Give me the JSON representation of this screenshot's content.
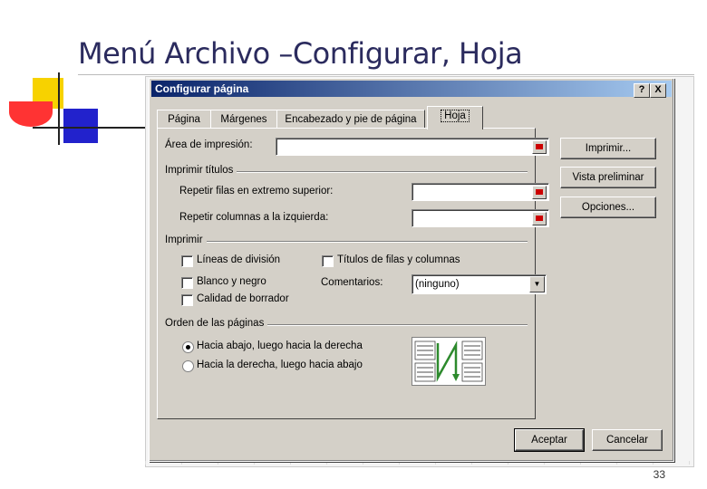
{
  "slide": {
    "title": "Menú Archivo –Configurar, Hoja",
    "page_number": "33"
  },
  "dialog": {
    "title": "Configurar página",
    "help_label": "?",
    "close_label": "X",
    "tabs": [
      {
        "label": "Página"
      },
      {
        "label": "Márgenes"
      },
      {
        "label": "Encabezado y pie de página"
      },
      {
        "label": "Hoja",
        "active": true
      }
    ],
    "print_area_label": "Área de impresión:",
    "print_area_value": "",
    "print_titles_group": "Imprimir títulos",
    "repeat_rows_label": "Repetir filas en extremo superior:",
    "repeat_rows_value": "",
    "repeat_cols_label": "Repetir columnas a la izquierda:",
    "repeat_cols_value": "",
    "print_group": "Imprimir",
    "gridlines_label": "Líneas de división",
    "gridlines_checked": false,
    "bw_label": "Blanco y negro",
    "bw_checked": false,
    "draft_label": "Calidad de borrador",
    "draft_checked": false,
    "headings_label": "Títulos de filas y columnas",
    "headings_checked": false,
    "comments_label": "Comentarios:",
    "comments_value": "(ninguno)",
    "page_order_group": "Orden de las páginas",
    "down_then_over_label": "Hacia abajo, luego hacia la derecha",
    "over_then_down_label": "Hacia la derecha, luego hacia abajo",
    "selected_order": "down_then_over",
    "print_button": "Imprimir...",
    "preview_button": "Vista preliminar",
    "options_button": "Opciones...",
    "ok_button": "Aceptar",
    "cancel_button": "Cancelar"
  },
  "colors": {
    "dialog_face": "#d4d0c8",
    "titlebar_start": "#0a246a",
    "titlebar_end": "#a6caf0",
    "slide_title": "#2b2b5e",
    "arrow_green": "#2d8a2d"
  }
}
